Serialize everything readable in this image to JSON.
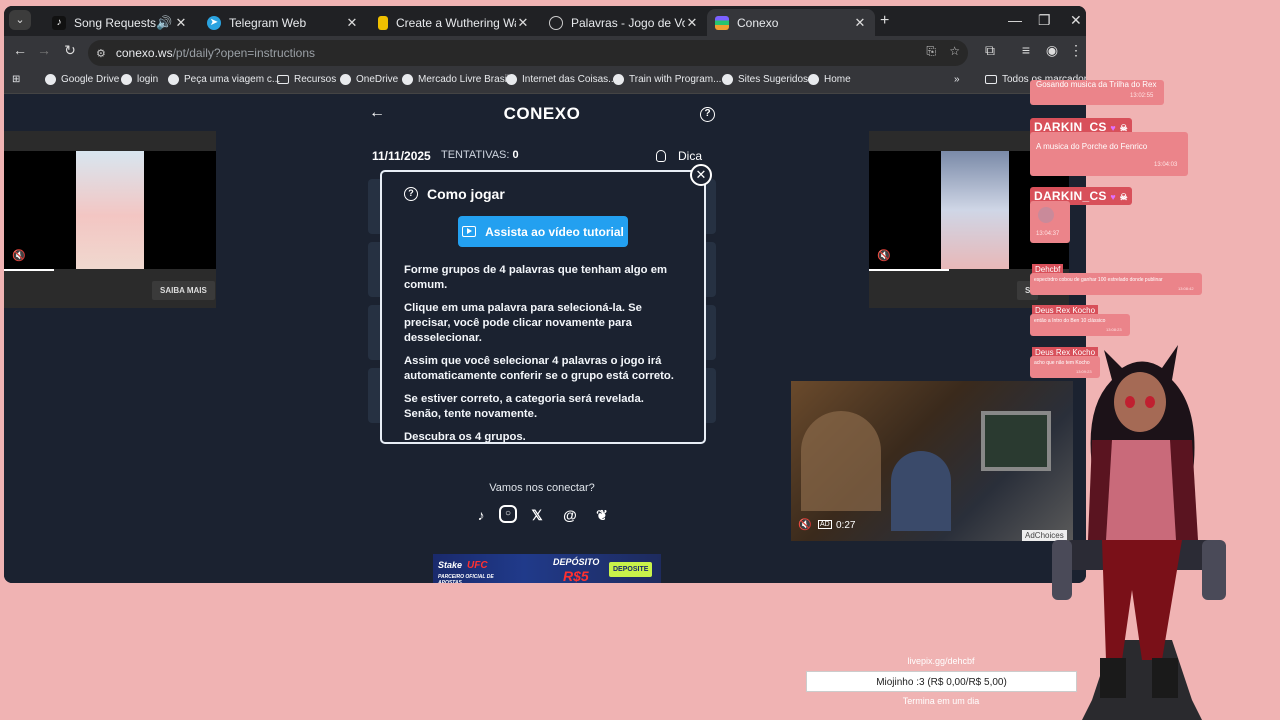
{
  "browser": {
    "tabs": [
      {
        "title": "Song Requests - Playing El...",
        "icon": "music-icon",
        "favcolor": "#202124",
        "audio": true
      },
      {
        "title": "Telegram Web",
        "icon": "telegram-icon",
        "favcolor": "#2aa3e0"
      },
      {
        "title": "Create a Wuthering Waves All E",
        "icon": "doc-icon",
        "favcolor": "#f0c000"
      },
      {
        "title": "Palavras - Jogo de Vocabulário",
        "icon": "globe-icon",
        "favcolor": "#9aa0a6"
      },
      {
        "title": "Conexo",
        "icon": "conexo-icon",
        "favcolor": "#7b61ff",
        "active": true
      }
    ],
    "url_host": "conexo.ws",
    "url_path": "/pt/daily?open=instructions",
    "bookmarks": [
      "Google Drive",
      "login",
      "Peça uma viagem c...",
      "Recursos",
      "OneDrive",
      "Mercado Livre Brasil",
      "Internet das Coisas...",
      "Train with Program...",
      "Sites Sugeridos",
      "Home"
    ],
    "all_bookmarks": "Todos os marcadores"
  },
  "game": {
    "title": "CONEXO",
    "date": "11/11/2025",
    "attempts_label": "TENTATIVAS:",
    "attempts_value": "0",
    "hint_label": "Dica"
  },
  "modal": {
    "heading": "Como jogar",
    "tutorial_button": "Assista ao vídeo tutorial",
    "paragraphs": [
      "Forme grupos de 4 palavras que tenham algo em comum.",
      "Clique em uma palavra para selecioná-la. Se precisar, você pode clicar novamente para desselecionar.",
      "Assim que você selecionar 4 palavras o jogo irá automaticamente conferir se o grupo está correto.",
      "Se estiver correto, a categoria será revelada. Senão, tente novamente.",
      "Descubra os 4 grupos."
    ]
  },
  "footer": {
    "connect": "Vamos nos conectar?",
    "socials": [
      "tiktok-icon",
      "instagram-icon",
      "x-icon",
      "threads-icon",
      "bluesky-icon"
    ]
  },
  "ads": {
    "left_cta": "SAIBA MAIS",
    "right_cta": "S",
    "banner_brand": "Stake",
    "banner_ufc": "UFC",
    "banner_sub": "PARCEIRO OFICIAL DE APOSTAS",
    "banner_deposit": "DEPÓSITO",
    "banner_amount": "R$5",
    "banner_button": "DEPOSITE",
    "video_time": "0:27",
    "video_ad": "AD",
    "adchoices": "AdChoices"
  },
  "stream": {
    "chat": [
      {
        "user": "",
        "text": "Gosando musica da Trilha do Rex",
        "time": "13:02:55"
      },
      {
        "user": "DARKIN_CS",
        "text": "A musica do Porche do Fenrico",
        "time": "13:04:03"
      },
      {
        "user": "DARKIN_CS",
        "text": "",
        "time": "13:04:37"
      },
      {
        "user": "Dehcbf",
        "text": "espectrdro cobou de ganhar 100 estrelado donde publinar",
        "time": "13:08:42"
      },
      {
        "user": "Deus Rex Kocho",
        "text": "então a Intro do Ben 10 clássico",
        "time": "13:08:23"
      },
      {
        "user": "Deus Rex Kocho",
        "text": "acho que não tem Kocho",
        "time": "13:09:23"
      }
    ],
    "donate_link": "livepix.gg/dehcbf",
    "donate_goal": "Miojinho :3 (R$ 0,00/R$ 5,00)",
    "donate_end": "Termina em um dia"
  }
}
